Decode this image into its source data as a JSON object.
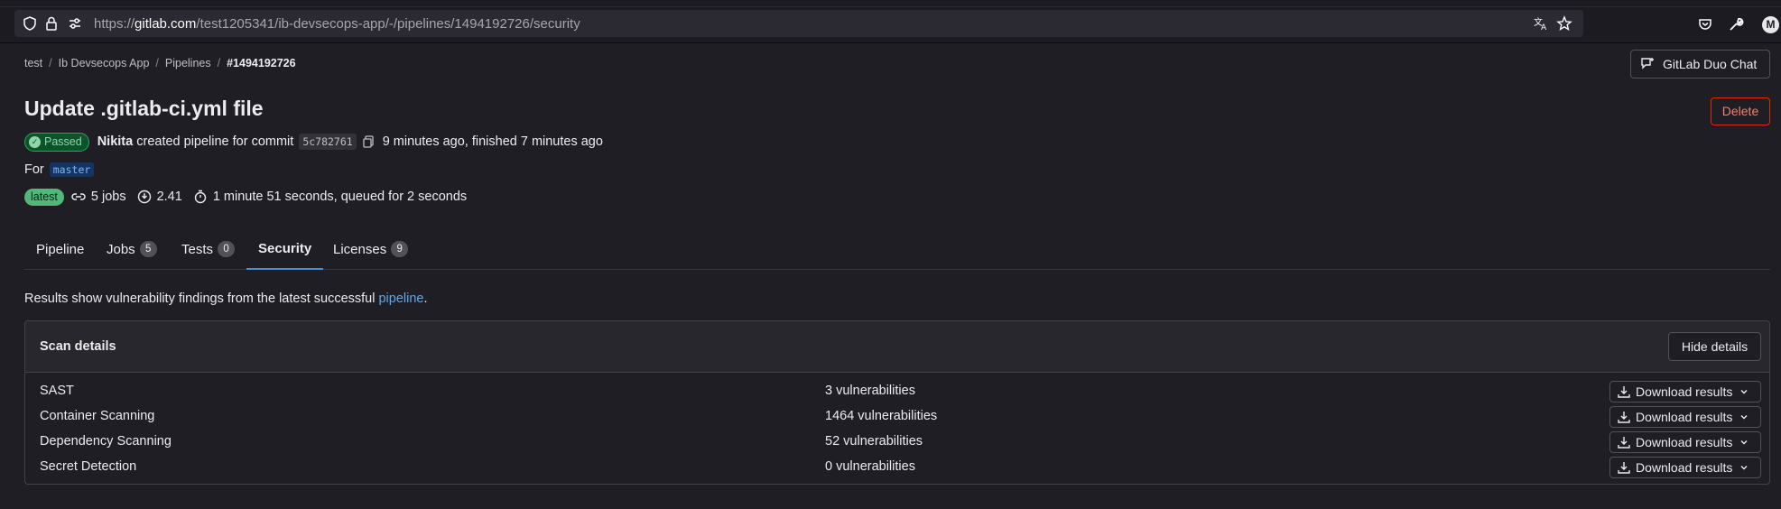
{
  "browser": {
    "url_prefix": "https://",
    "url_host": "gitlab.com",
    "url_path": "/test1205341/ib-devsecops-app/-/pipelines/1494192726/security",
    "avatar_letter": "M"
  },
  "breadcrumb": {
    "items": [
      "test",
      "Ib Devsecops App",
      "Pipelines"
    ],
    "current": "#1494192726"
  },
  "header": {
    "duo_label": "GitLab Duo Chat",
    "title": "Update .gitlab-ci.yml file",
    "delete_label": "Delete"
  },
  "pipeline": {
    "status": "Passed",
    "user": "Nikita",
    "created_text": "created pipeline for commit",
    "commit_sha": "5c782761",
    "time_text": "9 minutes ago, finished 7 minutes ago",
    "for_label": "For",
    "branch": "master",
    "latest_badge": "latest",
    "jobs": "5 jobs",
    "coverage": "2.41",
    "duration": "1 minute 51 seconds, queued for 2 seconds"
  },
  "tabs": [
    {
      "label": "Pipeline",
      "count": null
    },
    {
      "label": "Jobs",
      "count": "5"
    },
    {
      "label": "Tests",
      "count": "0"
    },
    {
      "label": "Security",
      "count": null,
      "active": true
    },
    {
      "label": "Licenses",
      "count": "9"
    }
  ],
  "security": {
    "info_prefix": "Results show vulnerability findings from the latest successful ",
    "info_link": "pipeline",
    "info_suffix": ".",
    "card_title": "Scan details",
    "hide_label": "Hide details",
    "download_label": "Download results",
    "scans": [
      {
        "name": "SAST",
        "vulnerabilities": "3 vulnerabilities"
      },
      {
        "name": "Container Scanning",
        "vulnerabilities": "1464 vulnerabilities"
      },
      {
        "name": "Dependency Scanning",
        "vulnerabilities": "52 vulnerabilities"
      },
      {
        "name": "Secret Detection",
        "vulnerabilities": "0 vulnerabilities"
      }
    ]
  },
  "colors": {
    "background": "#1f1e24",
    "accent_link": "#63a6e9",
    "success": "#2da160",
    "danger": "#dd2b0e"
  }
}
